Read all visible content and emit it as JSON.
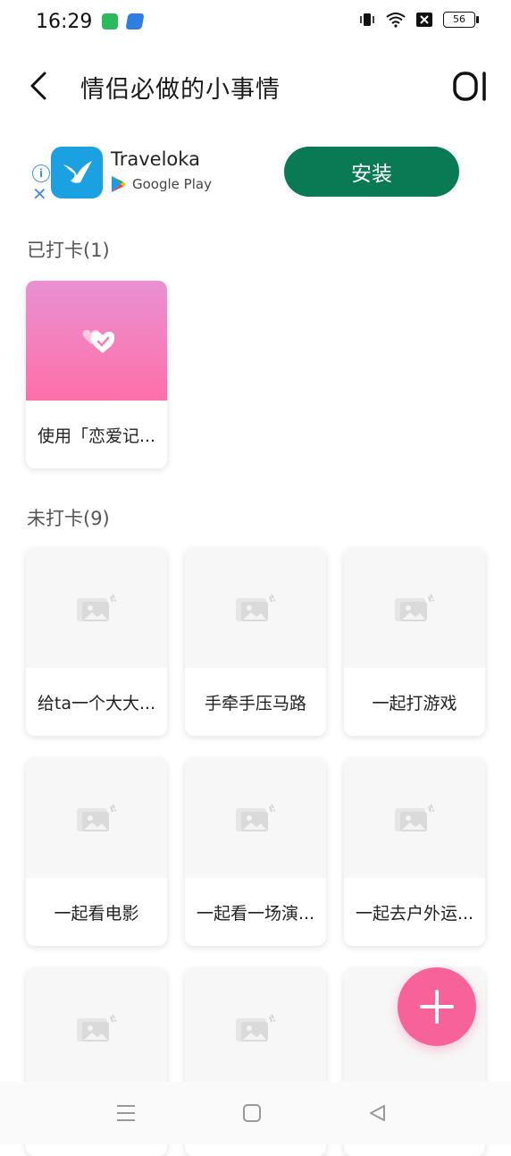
{
  "status_bar": {
    "time": "16:29",
    "battery": "56"
  },
  "header": {
    "title": "情侣必做的小事情"
  },
  "ad": {
    "app_name": "Traveloka",
    "store": "Google Play",
    "install_label": "安装"
  },
  "sections": {
    "done": {
      "title": "已打卡(1)",
      "items": [
        "使用「恋爱记..."
      ]
    },
    "todo": {
      "title": "未打卡(9)",
      "items": [
        "给ta一个大大...",
        "手牵手压马路",
        "一起打游戏",
        "一起看电影",
        "一起看一场演...",
        "一起去户外运...",
        "",
        "",
        ""
      ]
    }
  },
  "colors": {
    "accent_pink": "#f8629a",
    "install_green": "#097a54",
    "ad_icon_blue": "#1ba0e2"
  }
}
